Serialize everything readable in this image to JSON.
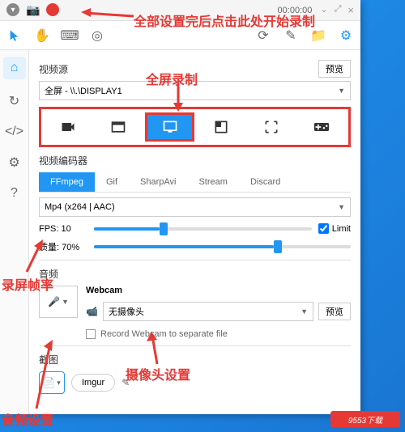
{
  "titlebar": {
    "timer": "00:00:00"
  },
  "annotations": {
    "record_hint": "全部设置完后点击此处开始录制",
    "fullscreen_hint": "全屏录制",
    "fps_hint": "录屏帧率",
    "audio_hint": "音频设置",
    "webcam_hint": "摄像头设置"
  },
  "content": {
    "video_source_label": "视频源",
    "preview_btn": "预览",
    "display_value": "全屏 - \\\\.\\DISPLAY1",
    "encoder_label": "视频编码器",
    "encoder_tabs": [
      "FFmpeg",
      "Gif",
      "SharpAvi",
      "Stream",
      "Discard"
    ],
    "codec_value": "Mp4 (x264 | AAC)",
    "fps_label": "FPS:",
    "fps_value": "10",
    "limit_label": "Limit",
    "quality_label": "质量:",
    "quality_value": "70%",
    "audio_label": "音频",
    "webcam_label": "Webcam",
    "webcam_value": "无摄像头",
    "webcam_preview": "预览",
    "record_separate": "Record Webcam to separate file",
    "screenshot_label": "截图",
    "imgur_label": "Imgur"
  },
  "watermark": "9553下载"
}
